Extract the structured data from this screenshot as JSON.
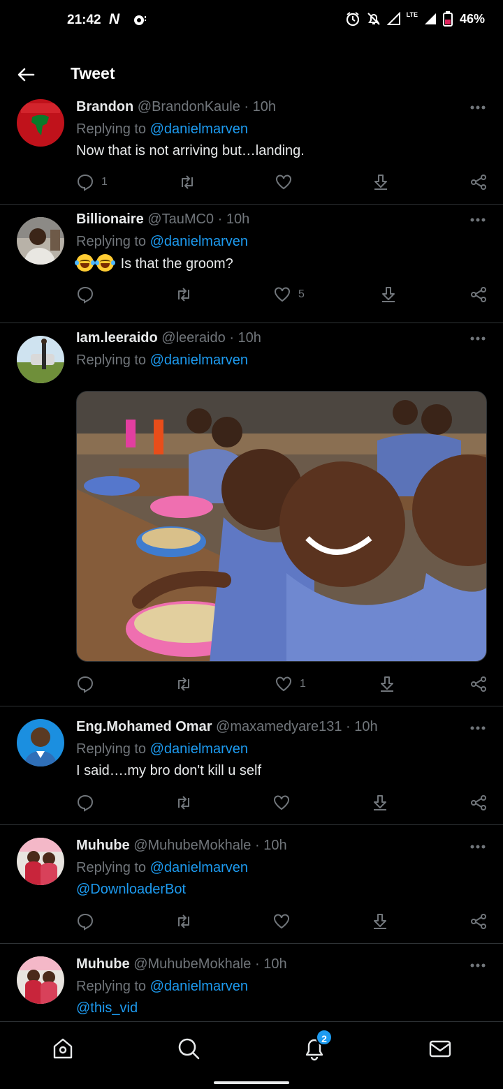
{
  "status_bar": {
    "time": "21:42",
    "notification_letter": "N",
    "network_label": "LTE",
    "battery": "46%"
  },
  "header": {
    "title": "Tweet"
  },
  "reply_prefix": "Replying to",
  "tweets": [
    {
      "name": "Brandon",
      "handle": "@BrandonKaule",
      "time": "10h",
      "replying_to": "@danielmarven",
      "text": "Now that is not arriving but…landing.",
      "reply_count": "1",
      "like_count": ""
    },
    {
      "name": "Billionaire",
      "handle": "@TauMC0",
      "time": "10h",
      "replying_to": "@danielmarven",
      "text": "Is that the groom?",
      "reply_count": "",
      "like_count": "5"
    },
    {
      "name": "Iam.leeraido",
      "handle": "@leeraido",
      "time": "10h",
      "replying_to": "@danielmarven",
      "text": "",
      "reply_count": "",
      "like_count": "1"
    },
    {
      "name": "Eng.Mohamed Omar",
      "handle": "@maxamedyare131",
      "time": "10h",
      "replying_to": "@danielmarven",
      "text": "I said….my bro don't kill u self",
      "reply_count": "",
      "like_count": ""
    },
    {
      "name": "Muhube",
      "handle": "@MuhubeMokhale",
      "time": "10h",
      "replying_to": "@danielmarven",
      "text": "@DownloaderBot",
      "reply_count": "",
      "like_count": ""
    },
    {
      "name": "Muhube",
      "handle": "@MuhubeMokhale",
      "time": "10h",
      "replying_to": "@danielmarven",
      "text": "@this_vid",
      "reply_count": "",
      "like_count": ""
    }
  ],
  "bottom_nav": {
    "notifications_badge": "2",
    "items": [
      "home-icon",
      "search-icon",
      "bell-icon",
      "mail-icon"
    ]
  },
  "colors": {
    "background": "#000000",
    "text": "#e7e9ea",
    "secondary": "#71767b",
    "accent": "#1d9bf0",
    "divider": "#2f3336"
  }
}
